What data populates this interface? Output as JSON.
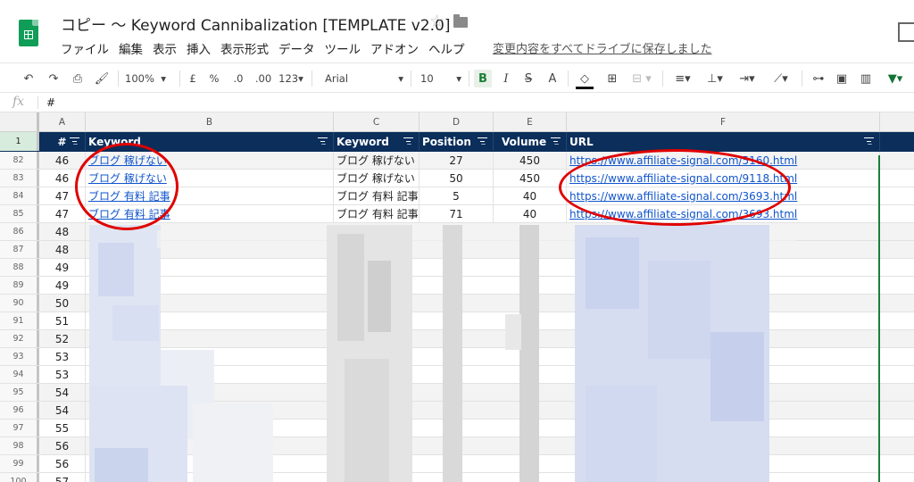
{
  "app": {
    "doc_title": "コピー 〜 Keyword Cannibalization [TEMPLATE v2.0]",
    "save_status": "変更内容をすべてドライブに保存しました"
  },
  "menu": [
    "ファイル",
    "編集",
    "表示",
    "挿入",
    "表示形式",
    "データ",
    "ツール",
    "アドオン",
    "ヘルプ"
  ],
  "toolbar": {
    "zoom": "100%",
    "currency": "£",
    "percent": "%",
    "decimal_less": ".0",
    "decimal_more": ".00",
    "format_more": "123▾",
    "font": "Arial",
    "font_size": "10",
    "bold": "B",
    "italic": "I",
    "strike": "S",
    "text_color": "A"
  },
  "formula_bar": {
    "fx": "fx",
    "content": "#"
  },
  "columns": [
    "A",
    "B",
    "C",
    "D",
    "E",
    "F"
  ],
  "header_row": {
    "row_num": "1",
    "cells": [
      "#",
      "Keyword",
      "Keyword",
      "Position",
      "Volume",
      "URL"
    ]
  },
  "rows": [
    {
      "row_num": "82",
      "num": "46",
      "kw": "ブログ 稼げない",
      "kw2": "ブログ 稼げない",
      "pos": "27",
      "vol": "450",
      "url": "https://www.affiliate-signal.com/5160.html"
    },
    {
      "row_num": "83",
      "num": "46",
      "kw": "ブログ 稼げない",
      "kw2": "ブログ 稼げない",
      "pos": "50",
      "vol": "450",
      "url": "https://www.affiliate-signal.com/9118.html"
    },
    {
      "row_num": "84",
      "num": "47",
      "kw": "ブログ 有料 記事",
      "kw2": "ブログ 有料 記事",
      "pos": "5",
      "vol": "40",
      "url": "https://www.affiliate-signal.com/3693.html"
    },
    {
      "row_num": "85",
      "num": "47",
      "kw": "ブログ 有料 記事",
      "kw2": "ブログ 有料 記事",
      "pos": "71",
      "vol": "40",
      "url": "https://www.affiliate-signal.com/3693.html"
    },
    {
      "row_num": "86",
      "num": "48"
    },
    {
      "row_num": "87",
      "num": "48"
    },
    {
      "row_num": "88",
      "num": "49"
    },
    {
      "row_num": "89",
      "num": "49"
    },
    {
      "row_num": "90",
      "num": "50"
    },
    {
      "row_num": "91",
      "num": "51"
    },
    {
      "row_num": "92",
      "num": "52"
    },
    {
      "row_num": "93",
      "num": "53"
    },
    {
      "row_num": "94",
      "num": "53"
    },
    {
      "row_num": "95",
      "num": "54"
    },
    {
      "row_num": "96",
      "num": "54"
    },
    {
      "row_num": "97",
      "num": "55"
    },
    {
      "row_num": "98",
      "num": "56"
    },
    {
      "row_num": "99",
      "num": "56"
    },
    {
      "row_num": "100",
      "num": "57"
    }
  ],
  "colors": {
    "header_bg": "#0b2e5b",
    "link": "#1155cc",
    "annotation": "#e00000",
    "brand_green": "#0f9d58"
  }
}
